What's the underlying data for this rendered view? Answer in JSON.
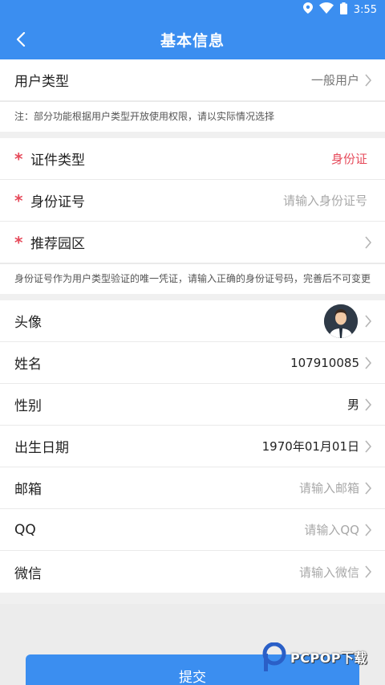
{
  "status_bar": {
    "time": "3:55"
  },
  "header": {
    "title": "基本信息"
  },
  "user_type": {
    "label": "用户类型",
    "value": "一般用户",
    "note": "注：部分功能根据用户类型开放使用权限，请以实际情况选择"
  },
  "identity": {
    "id_type": {
      "star": "*",
      "label": "证件类型",
      "value": "身份证"
    },
    "id_number": {
      "star": "*",
      "label": "身份证号",
      "placeholder": "请输入身份证号"
    },
    "park": {
      "star": "*",
      "label": "推荐园区"
    },
    "note": "身份证号作为用户类型验证的唯一凭证，请输入正确的身份证号码，完善后不可变更"
  },
  "profile": {
    "avatar": {
      "label": "头像"
    },
    "name": {
      "label": "姓名",
      "value": "107910085"
    },
    "gender": {
      "label": "性别",
      "value": "男"
    },
    "birth": {
      "label": "出生日期",
      "value": "1970年01月01日"
    },
    "email": {
      "label": "邮箱",
      "placeholder": "请输入邮箱"
    },
    "qq": {
      "label": "QQ",
      "placeholder": "请输入QQ"
    },
    "wechat": {
      "label": "微信",
      "placeholder": "请输入微信"
    }
  },
  "submit_label": "提交",
  "watermark": "PCPOP下载",
  "colors": {
    "primary": "#3b8ef0",
    "required": "#e64a5a",
    "placeholder": "#a8a8a8"
  }
}
